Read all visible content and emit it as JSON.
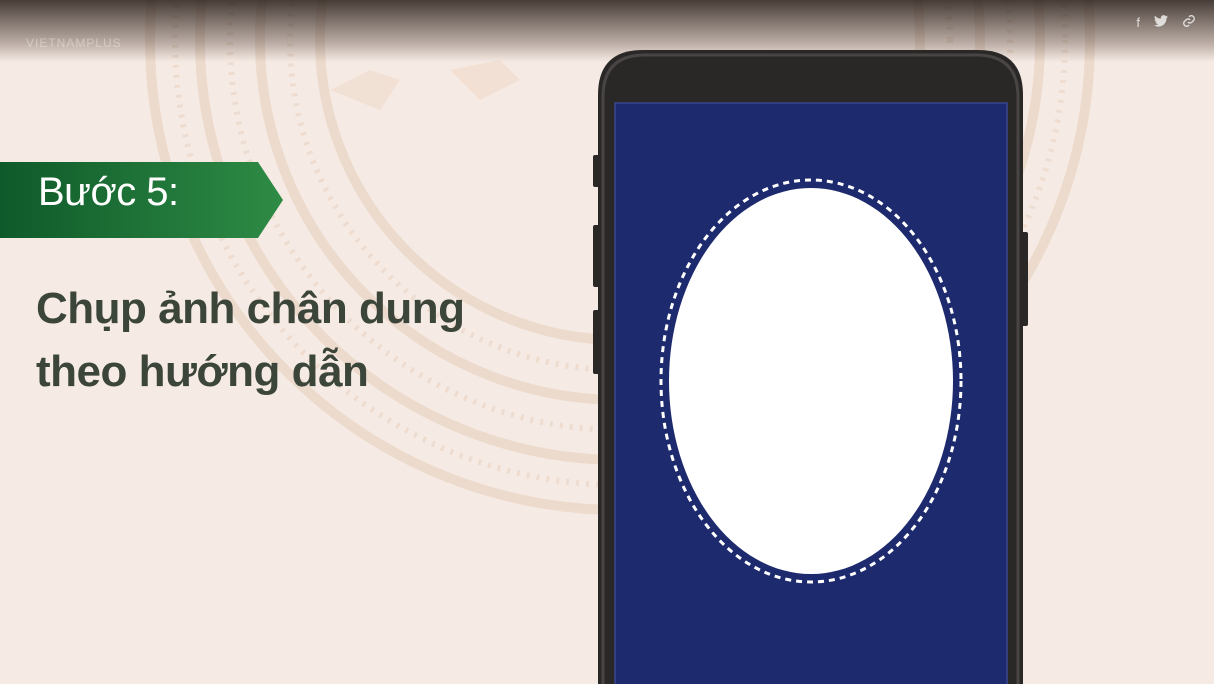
{
  "step": {
    "label": "Bước 5:"
  },
  "title": {
    "line1": "Chụp ảnh chân dung",
    "line2": "theo hướng dẫn"
  },
  "top_bar": {
    "blurred_text": "VIETNAMPLUS"
  },
  "share": [
    {
      "icon": "facebook-icon",
      "glyph": "f"
    },
    {
      "icon": "twitter-icon",
      "glyph": "🐦"
    },
    {
      "icon": "link-icon",
      "glyph": "🔗"
    }
  ],
  "colors": {
    "background": "#f6ebe4",
    "banner_green": "#1f7a3d",
    "banner_green_dark": "#0f5a2a",
    "title_text": "#3b4539",
    "phone_body": "#2a2727",
    "screen_blue": "#1d2a6e",
    "oval_fill": "#ffffff"
  }
}
